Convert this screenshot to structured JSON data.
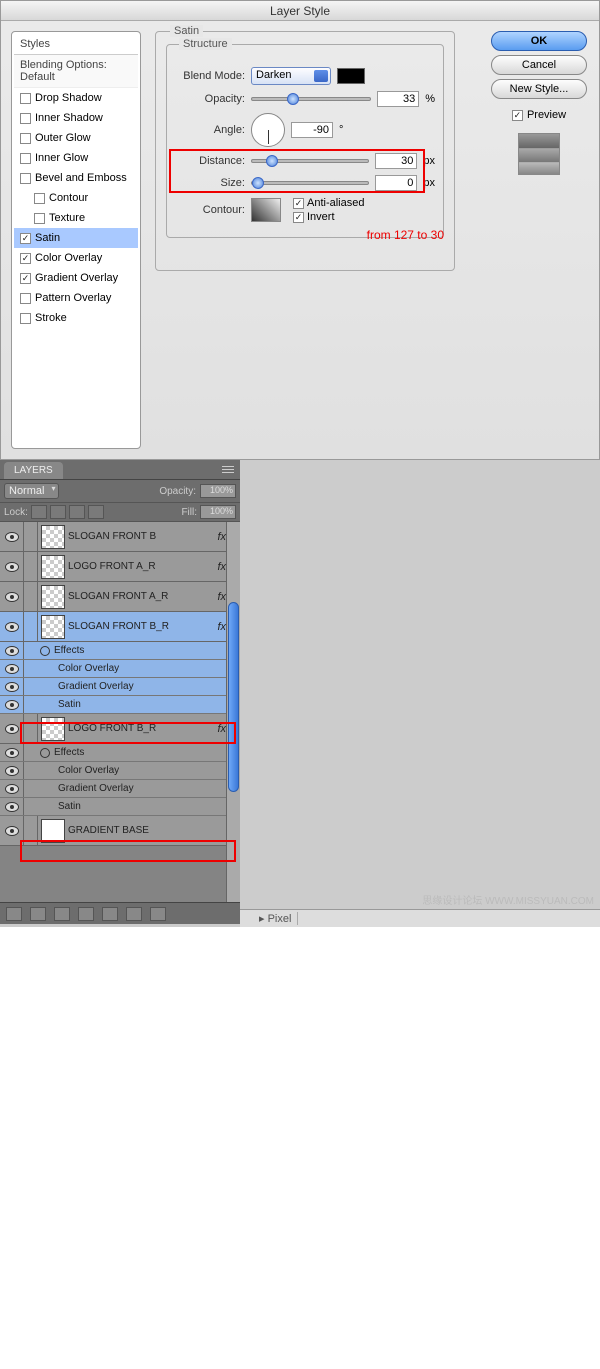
{
  "dialog": {
    "title": "Layer Style",
    "styles_header": "Styles",
    "blending_options": "Blending Options: Default",
    "items": [
      {
        "label": "Drop Shadow",
        "checked": false
      },
      {
        "label": "Inner Shadow",
        "checked": false
      },
      {
        "label": "Outer Glow",
        "checked": false
      },
      {
        "label": "Inner Glow",
        "checked": false
      },
      {
        "label": "Bevel and Emboss",
        "checked": false
      },
      {
        "label": "Contour",
        "checked": false,
        "indent": true
      },
      {
        "label": "Texture",
        "checked": false,
        "indent": true
      },
      {
        "label": "Satin",
        "checked": true,
        "selected": true
      },
      {
        "label": "Color Overlay",
        "checked": true
      },
      {
        "label": "Gradient Overlay",
        "checked": true
      },
      {
        "label": "Pattern Overlay",
        "checked": false
      },
      {
        "label": "Stroke",
        "checked": false
      }
    ],
    "satin": {
      "title": "Satin",
      "structure": "Structure",
      "blend_mode_label": "Blend Mode:",
      "blend_mode_value": "Darken",
      "opacity_label": "Opacity:",
      "opacity_value": "33",
      "opacity_unit": "%",
      "angle_label": "Angle:",
      "angle_value": "-90",
      "angle_unit": "°",
      "distance_label": "Distance:",
      "distance_value": "30",
      "distance_unit": "px",
      "size_label": "Size:",
      "size_value": "0",
      "size_unit": "px",
      "contour_label": "Contour:",
      "antialiased_label": "Anti-aliased",
      "invert_label": "Invert"
    },
    "annotation": "from 127 to 30",
    "buttons": {
      "ok": "OK",
      "cancel": "Cancel",
      "new_style": "New Style...",
      "preview": "Preview"
    }
  },
  "layers_panel": {
    "tab": "LAYERS",
    "blend_mode": "Normal",
    "opacity_label": "Opacity:",
    "opacity_value": "100%",
    "lock_label": "Lock:",
    "fill_label": "Fill:",
    "fill_value": "100%",
    "rows": [
      {
        "name": "SLOGAN FRONT B",
        "fx": true,
        "collapsed": true
      },
      {
        "name": "LOGO FRONT A_R",
        "fx": true,
        "collapsed": true
      },
      {
        "name": "SLOGAN FRONT A_R",
        "fx": true,
        "collapsed": true
      },
      {
        "name": "SLOGAN FRONT B_R",
        "fx": true,
        "collapsed": false,
        "selected": true,
        "effects": [
          "Color Overlay",
          "Gradient Overlay",
          "Satin"
        ]
      },
      {
        "name": "LOGO FRONT B_R",
        "fx": true,
        "collapsed": false,
        "effects": [
          "Color Overlay",
          "Gradient Overlay",
          "Satin"
        ]
      },
      {
        "name": "GRADIENT BASE",
        "fx": false,
        "collapsed": true,
        "solid": true
      }
    ],
    "effects_label": "Effects"
  },
  "bottom": {
    "unit": "Pixel",
    "watermark": "思缘设计论坛  WWW.MISSYUAN.COM"
  }
}
